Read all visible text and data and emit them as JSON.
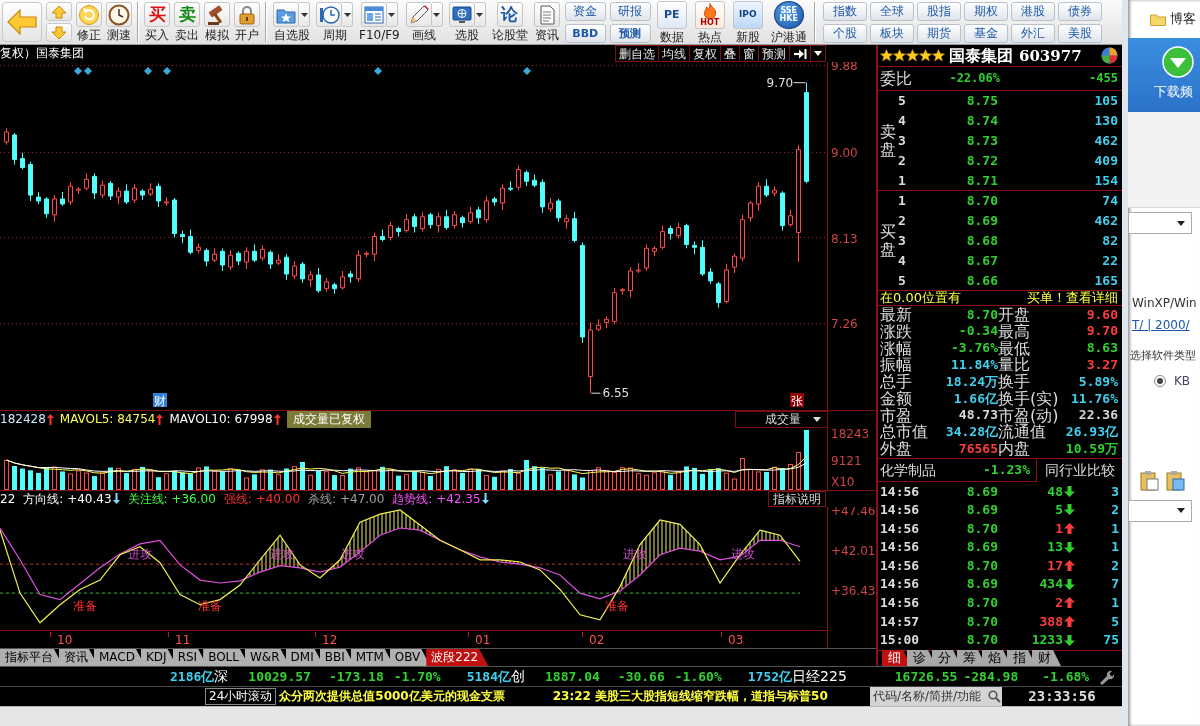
{
  "toolbar": {
    "quick_tools": [
      {
        "label": "修正"
      },
      {
        "label": "测速"
      }
    ],
    "trade_tools": [
      {
        "label": "买入",
        "glyph": "买",
        "color": "#e01010"
      },
      {
        "label": "卖出",
        "glyph": "卖",
        "color": "#108a10"
      },
      {
        "label": "模拟"
      },
      {
        "label": "开户"
      }
    ],
    "menu_tools": [
      {
        "label": "自选股",
        "dropdown": true
      },
      {
        "label": "周期",
        "dropdown": true
      },
      {
        "label": "F10/F9",
        "dropdown": true
      },
      {
        "label": "画线",
        "dropdown": true
      },
      {
        "label": "选股",
        "dropdown": true
      },
      {
        "label": "论股堂",
        "glyph": "论",
        "dropdown": false
      },
      {
        "label": "资讯",
        "dropdown": false
      }
    ],
    "stacked_tools": [
      {
        "top": "资金",
        "bottom": "BBD"
      },
      {
        "top": "研报",
        "bottom": "预测"
      }
    ],
    "feature_tools": [
      {
        "label": "数据",
        "badge": "PE"
      },
      {
        "label": "热点",
        "badge": "HOT"
      },
      {
        "label": "新股",
        "badge": "IPO"
      },
      {
        "label": "沪港通",
        "badge": "SSE HKE"
      }
    ],
    "market_tools": [
      "指数",
      "全球",
      "股指",
      "期权",
      "港股",
      "债券",
      "个股",
      "板块",
      "期货",
      "基金",
      "外汇",
      "美股"
    ]
  },
  "chart": {
    "title": "复权）国泰集团",
    "tools": [
      "删自选",
      "均线",
      "复权",
      "叠",
      "窗",
      "预测"
    ],
    "high_label": "9.70",
    "low_label": "6.55",
    "markers": [
      {
        "text": "财",
        "color": "#2f7fd8"
      },
      {
        "text": "张",
        "color": "#900000"
      }
    ],
    "chart_data": {
      "type": "candlestick",
      "grid": true,
      "ylim": [
        6.38,
        9.91
      ],
      "yticks": [
        {
          "value": 9.88,
          "label": "9.88"
        },
        {
          "value": 9.0,
          "label": "9.00"
        },
        {
          "value": 8.13,
          "label": "8.13"
        },
        {
          "value": 7.26,
          "label": "7.26"
        }
      ],
      "ohlc": [
        [
          9.1,
          9.24,
          9.07,
          9.2
        ],
        [
          9.17,
          9.19,
          8.87,
          8.92
        ],
        [
          8.93,
          8.99,
          8.82,
          8.84
        ],
        [
          8.87,
          8.9,
          8.5,
          8.56
        ],
        [
          8.54,
          8.59,
          8.47,
          8.5
        ],
        [
          8.52,
          8.54,
          8.33,
          8.37
        ],
        [
          8.36,
          8.56,
          8.29,
          8.52
        ],
        [
          8.52,
          8.59,
          8.45,
          8.47
        ],
        [
          8.49,
          8.69,
          8.46,
          8.65
        ],
        [
          8.62,
          8.64,
          8.57,
          8.62
        ],
        [
          8.63,
          8.78,
          8.61,
          8.72
        ],
        [
          8.75,
          8.78,
          8.52,
          8.58
        ],
        [
          8.56,
          8.71,
          8.53,
          8.66
        ],
        [
          8.68,
          8.7,
          8.51,
          8.55
        ],
        [
          8.54,
          8.64,
          8.47,
          8.6
        ],
        [
          8.6,
          8.67,
          8.47,
          8.49
        ],
        [
          8.51,
          8.67,
          8.48,
          8.63
        ],
        [
          8.6,
          8.62,
          8.51,
          8.56
        ],
        [
          8.57,
          8.68,
          8.55,
          8.62
        ],
        [
          8.65,
          8.68,
          8.44,
          8.5
        ],
        [
          8.48,
          8.54,
          8.45,
          8.49
        ],
        [
          8.51,
          8.53,
          8.13,
          8.17
        ],
        [
          8.16,
          8.2,
          8.07,
          8.14
        ],
        [
          8.14,
          8.21,
          7.96,
          7.98
        ],
        [
          8.0,
          8.07,
          7.97,
          8.03
        ],
        [
          8.0,
          8.02,
          7.84,
          7.89
        ],
        [
          7.9,
          8.02,
          7.88,
          7.96
        ],
        [
          7.99,
          8.02,
          7.79,
          7.85
        ],
        [
          7.83,
          8.0,
          7.8,
          7.95
        ],
        [
          7.97,
          7.99,
          7.85,
          7.89
        ],
        [
          7.88,
          8.03,
          7.81,
          7.99
        ],
        [
          7.99,
          8.06,
          7.88,
          7.9
        ],
        [
          7.92,
          8.05,
          7.89,
          8.01
        ],
        [
          7.98,
          8.0,
          7.81,
          7.86
        ],
        [
          7.87,
          7.96,
          7.85,
          7.9
        ],
        [
          7.93,
          7.96,
          7.7,
          7.76
        ],
        [
          7.74,
          7.89,
          7.71,
          7.84
        ],
        [
          7.86,
          7.88,
          7.67,
          7.71
        ],
        [
          7.7,
          7.79,
          7.63,
          7.75
        ],
        [
          7.75,
          7.82,
          7.57,
          7.59
        ],
        [
          7.61,
          7.72,
          7.58,
          7.68
        ],
        [
          7.65,
          7.67,
          7.56,
          7.61
        ],
        [
          7.62,
          7.79,
          7.6,
          7.73
        ],
        [
          7.76,
          7.79,
          7.67,
          7.73
        ],
        [
          7.71,
          8.0,
          7.68,
          7.95
        ],
        [
          7.97,
          7.99,
          7.93,
          7.97
        ],
        [
          7.96,
          8.18,
          7.89,
          8.14
        ],
        [
          8.14,
          8.21,
          8.09,
          8.11
        ],
        [
          8.13,
          8.29,
          8.1,
          8.25
        ],
        [
          8.22,
          8.24,
          8.14,
          8.19
        ],
        [
          8.2,
          8.37,
          8.18,
          8.31
        ],
        [
          8.34,
          8.37,
          8.18,
          8.24
        ],
        [
          8.22,
          8.39,
          8.19,
          8.34
        ],
        [
          8.36,
          8.38,
          8.22,
          8.26
        ],
        [
          8.25,
          8.38,
          8.18,
          8.34
        ],
        [
          8.34,
          8.41,
          8.21,
          8.23
        ],
        [
          8.25,
          8.4,
          8.22,
          8.36
        ],
        [
          8.33,
          8.35,
          8.23,
          8.28
        ],
        [
          8.29,
          8.44,
          8.27,
          8.38
        ],
        [
          8.41,
          8.44,
          8.27,
          8.33
        ],
        [
          8.31,
          8.55,
          8.28,
          8.5
        ],
        [
          8.52,
          8.54,
          8.45,
          8.49
        ],
        [
          8.48,
          8.67,
          8.41,
          8.63
        ],
        [
          8.63,
          8.7,
          8.6,
          8.62
        ],
        [
          8.64,
          8.86,
          8.61,
          8.82
        ],
        [
          8.79,
          8.81,
          8.65,
          8.7
        ],
        [
          8.71,
          8.77,
          8.64,
          8.66
        ],
        [
          8.69,
          8.72,
          8.38,
          8.44
        ],
        [
          8.42,
          8.53,
          8.39,
          8.48
        ],
        [
          8.5,
          8.52,
          8.29,
          8.33
        ],
        [
          8.29,
          8.36,
          8.22,
          8.32
        ],
        [
          8.32,
          8.39,
          8.08,
          8.1
        ],
        [
          8.05,
          8.08,
          7.06,
          7.12
        ],
        [
          6.72,
          7.27,
          6.55,
          7.19
        ],
        [
          7.2,
          7.3,
          7.18,
          7.24
        ],
        [
          7.27,
          7.33,
          7.21,
          7.3
        ],
        [
          7.28,
          7.62,
          7.25,
          7.57
        ],
        [
          7.59,
          7.62,
          7.55,
          7.6
        ],
        [
          7.59,
          7.83,
          7.52,
          7.79
        ],
        [
          7.79,
          7.87,
          7.77,
          7.8
        ],
        [
          7.82,
          8.06,
          7.79,
          8.02
        ],
        [
          7.99,
          8.04,
          7.94,
          8.02
        ],
        [
          8.03,
          8.25,
          8.01,
          8.19
        ],
        [
          8.22,
          8.25,
          8.11,
          8.17
        ],
        [
          8.15,
          8.28,
          8.12,
          8.23
        ],
        [
          8.25,
          8.27,
          8.02,
          8.06
        ],
        [
          8.05,
          8.09,
          7.96,
          8.03
        ],
        [
          8.03,
          8.1,
          7.74,
          7.76
        ],
        [
          7.78,
          7.82,
          7.66,
          7.69
        ],
        [
          7.66,
          7.68,
          7.42,
          7.47
        ],
        [
          7.48,
          7.86,
          7.46,
          7.8
        ],
        [
          7.83,
          7.97,
          7.77,
          7.94
        ],
        [
          7.92,
          8.36,
          7.89,
          8.31
        ],
        [
          8.33,
          8.5,
          8.29,
          8.48
        ],
        [
          8.47,
          8.69,
          8.4,
          8.65
        ],
        [
          8.65,
          8.72,
          8.54,
          8.56
        ],
        [
          8.58,
          8.65,
          8.55,
          8.61
        ],
        [
          8.58,
          8.6,
          8.2,
          8.25
        ],
        [
          8.26,
          8.41,
          8.24,
          8.35
        ],
        [
          8.18,
          9.07,
          7.88,
          9.02
        ],
        [
          9.6,
          9.7,
          8.68,
          8.7
        ]
      ]
    }
  },
  "volume": {
    "readings": [
      {
        "text": "182428",
        "color": "#d0e8ff",
        "rising": true
      },
      {
        "text": "MAVOL5: 84754",
        "color": "#ffff50",
        "rising": true
      },
      {
        "text": "MAVOL10: 67998",
        "color": "#ffffff",
        "rising": true
      }
    ],
    "tooltip": "成交量已复权",
    "selector": "成交量",
    "ticks": [
      "18243",
      "9121",
      "X10"
    ]
  },
  "indicator": {
    "readings": [
      {
        "text": "22",
        "color": "#ffffff",
        "falling": false
      },
      {
        "text": "方向线: +40.43",
        "color": "#ffffff",
        "falling": true
      },
      {
        "text": "关注线: +36.00",
        "color": "#40ff40",
        "falling": false
      },
      {
        "text": "强线: +40.00",
        "color": "#ff3030",
        "falling": false
      },
      {
        "text": "杀线: +47.00",
        "color": "#a0a0a0",
        "falling": false
      },
      {
        "text": "趋势线: +42.35",
        "color": "#ff50ff",
        "falling": true
      }
    ],
    "help_button": "指标说明",
    "chart_data": {
      "type": "line",
      "ylim": [
        30.9,
        47.9
      ],
      "yticks": [
        {
          "value": 47.46,
          "label": "+47.46"
        },
        {
          "value": 42.01,
          "label": "+42.01"
        },
        {
          "value": 36.43,
          "label": "+36.43"
        }
      ],
      "series": [
        {
          "color": "#f0f050",
          "values": [
            44.7,
            36.0,
            31.9,
            34.4,
            36.5,
            37.8,
            41.3,
            42.4,
            40.2,
            35.8,
            34.4,
            35.1,
            37.1,
            40.6,
            44.0,
            39.9,
            38.1,
            40.6,
            45.8,
            46.9,
            47.5,
            45.4,
            43.3,
            42.0,
            40.6,
            40.6,
            40.3,
            39.2,
            36.5,
            33.0,
            32.3,
            36.9,
            42.7,
            46.1,
            45.5,
            42.7,
            37.4,
            41.3,
            44.7,
            44.0,
            40.4
          ]
        },
        {
          "color": "#e050e0",
          "values": [
            45.0,
            40.6,
            35.8,
            35.1,
            37.3,
            39.5,
            41.4,
            42.8,
            43.3,
            39.9,
            37.8,
            37.4,
            37.7,
            38.9,
            39.8,
            39.5,
            38.9,
            39.6,
            41.7,
            44.0,
            45.0,
            44.7,
            43.3,
            42.0,
            41.0,
            40.3,
            40.0,
            39.5,
            38.5,
            36.0,
            35.2,
            36.3,
            38.5,
            41.3,
            42.2,
            41.8,
            40.6,
            41.1,
            43.3,
            43.3,
            42.4
          ]
        },
        {
          "color": "#c03030",
          "line_style": "dashed",
          "values": [
            40.0,
            40.0,
            40.0,
            40.0,
            40.0,
            40.0,
            40.0,
            40.0,
            40.0,
            40.0,
            40.0,
            40.0,
            40.0,
            40.0,
            40.0,
            40.0,
            40.0,
            40.0,
            40.0,
            40.0,
            40.0,
            40.0,
            40.0,
            40.0,
            40.0,
            40.0,
            40.0,
            40.0,
            40.0,
            40.0,
            40.0,
            40.0,
            40.0,
            40.0,
            40.0,
            40.0,
            40.0,
            40.0,
            40.0,
            40.0,
            40.0
          ]
        },
        {
          "color": "#30c030",
          "line_style": "dashed",
          "values": [
            36.0,
            36.0,
            36.0,
            36.0,
            36.0,
            36.0,
            36.0,
            36.0,
            36.0,
            36.0,
            36.0,
            36.0,
            36.0,
            36.0,
            36.0,
            36.0,
            36.0,
            36.0,
            36.0,
            36.0,
            36.0,
            36.0,
            36.0,
            36.0,
            36.0,
            36.0,
            36.0,
            36.0,
            36.0,
            36.0,
            36.0,
            36.0,
            36.0,
            36.0,
            36.0,
            36.0,
            36.0,
            36.0,
            36.0,
            36.0,
            36.0
          ]
        }
      ]
    },
    "signals": [
      {
        "text": "进攻",
        "kind": "attack"
      },
      {
        "text": "进攻",
        "kind": "attack"
      },
      {
        "text": "进攻",
        "kind": "attack"
      },
      {
        "text": "进攻",
        "kind": "attack"
      },
      {
        "text": "进攻",
        "kind": "attack"
      },
      {
        "text": "准备",
        "kind": "ready"
      },
      {
        "text": "准备",
        "kind": "ready"
      },
      {
        "text": "准备",
        "kind": "ready"
      }
    ]
  },
  "x_labels": [
    "10",
    "11",
    "12",
    "01",
    "02",
    "03"
  ],
  "indicator_tabs": [
    {
      "label": "指标平台",
      "selected": false
    },
    {
      "label": "资讯",
      "selected": false
    },
    {
      "label": "MACD",
      "selected": false
    },
    {
      "label": "KDJ",
      "selected": false
    },
    {
      "label": "RSI",
      "selected": false
    },
    {
      "label": "BOLL",
      "selected": false
    },
    {
      "label": "W&R",
      "selected": false
    },
    {
      "label": "DMI",
      "selected": false
    },
    {
      "label": "BBI",
      "selected": false
    },
    {
      "label": "MTM",
      "selected": false
    },
    {
      "label": "OBV",
      "selected": false
    },
    {
      "label": "波段222",
      "selected": true
    }
  ],
  "quote": {
    "stars": 5,
    "name": "国泰集团",
    "code": "603977",
    "ratio": {
      "label": "委比",
      "percent": "-22.06%",
      "difference": "-455"
    },
    "sell_label": "卖盘",
    "sell": [
      {
        "rank": "5",
        "price": "8.75",
        "volume": "105"
      },
      {
        "rank": "4",
        "price": "8.74",
        "volume": "130"
      },
      {
        "rank": "3",
        "price": "8.73",
        "volume": "462"
      },
      {
        "rank": "2",
        "price": "8.72",
        "volume": "409"
      },
      {
        "rank": "1",
        "price": "8.71",
        "volume": "154"
      }
    ],
    "buy_label": "买盘",
    "buy": [
      {
        "rank": "1",
        "price": "8.70",
        "volume": "74"
      },
      {
        "rank": "2",
        "price": "8.69",
        "volume": "462"
      },
      {
        "rank": "3",
        "price": "8.68",
        "volume": "82"
      },
      {
        "rank": "4",
        "price": "8.67",
        "volume": "22"
      },
      {
        "rank": "5",
        "price": "8.66",
        "volume": "165"
      }
    ],
    "notice": {
      "text": "在0.00位置有",
      "link": "买单！查看详细"
    },
    "stats": [
      {
        "label": "最新",
        "value": "8.70",
        "color": "#30d030"
      },
      {
        "label": "开盘",
        "value": "9.60",
        "color": "#ff3c3c"
      },
      {
        "label": "涨跌",
        "value": "-0.34",
        "color": "#30d030"
      },
      {
        "label": "最高",
        "value": "9.70",
        "color": "#ff3c3c"
      },
      {
        "label": "涨幅",
        "value": "-3.76%",
        "color": "#30d030"
      },
      {
        "label": "最低",
        "value": "8.63",
        "color": "#30d030"
      },
      {
        "label": "振幅",
        "value": "11.84%",
        "color": "#40d0f0"
      },
      {
        "label": "量比",
        "value": "3.27",
        "color": "#ff3c3c"
      },
      {
        "label": "总手",
        "value": "18.24万",
        "color": "#40d0f0"
      },
      {
        "label": "换手",
        "value": "5.89%",
        "color": "#40d0f0"
      },
      {
        "label": "金额",
        "value": "1.66亿",
        "color": "#40d0f0"
      },
      {
        "label": "换手(实)",
        "value": "11.76%",
        "color": "#40d0f0"
      },
      {
        "label": "市盈",
        "value": "48.73",
        "color": "#d8d8d8"
      },
      {
        "label": "市盈(动)",
        "value": "22.36",
        "color": "#d8d8d8"
      },
      {
        "label": "总市值",
        "value": "34.28亿",
        "color": "#40d0f0"
      },
      {
        "label": "流通值",
        "value": "26.93亿",
        "color": "#40d0f0"
      },
      {
        "label": "外盘",
        "value": "76565",
        "color": "#ff3c3c"
      },
      {
        "label": "内盘",
        "value": "10.59万",
        "color": "#30d030"
      }
    ],
    "industry": {
      "name": "化学制品",
      "change": "-1.23%",
      "button": "同行业比较"
    },
    "ticks": [
      {
        "time": "14:56",
        "price": "8.69",
        "volume": "48",
        "rising": false,
        "count": "3"
      },
      {
        "time": "14:56",
        "price": "8.69",
        "volume": "5",
        "rising": false,
        "count": "2"
      },
      {
        "time": "14:56",
        "price": "8.70",
        "volume": "1",
        "rising": true,
        "count": "1"
      },
      {
        "time": "14:56",
        "price": "8.69",
        "volume": "13",
        "rising": false,
        "count": "1"
      },
      {
        "time": "14:56",
        "price": "8.70",
        "volume": "17",
        "rising": true,
        "count": "2"
      },
      {
        "time": "14:56",
        "price": "8.69",
        "volume": "434",
        "rising": false,
        "count": "7"
      },
      {
        "time": "14:56",
        "price": "8.70",
        "volume": "2",
        "rising": true,
        "count": "1"
      },
      {
        "time": "14:57",
        "price": "8.70",
        "volume": "388",
        "rising": true,
        "count": "5"
      },
      {
        "time": "15:00",
        "price": "8.70",
        "volume": "1233",
        "rising": false,
        "count": "75"
      }
    ],
    "tabs": [
      {
        "label": "细",
        "selected": true
      },
      {
        "label": "诊",
        "selected": false
      },
      {
        "label": "分",
        "selected": false
      },
      {
        "label": "筹",
        "selected": false
      },
      {
        "label": "焰",
        "selected": false
      },
      {
        "label": "指",
        "selected": false
      },
      {
        "label": "财",
        "selected": false
      }
    ]
  },
  "status": {
    "lead_amount": "2186亿",
    "indices": [
      {
        "name": "深",
        "value": "10029.57",
        "change": "-173.18",
        "percent": "-1.70%",
        "amount": "5184亿"
      },
      {
        "name": "创",
        "value": "1887.04",
        "change": "-30.66",
        "percent": "-1.60%",
        "amount": "1752亿"
      },
      {
        "name": "日经225",
        "value": "16726.55",
        "change": "-284.98",
        "percent": "-1.68%"
      }
    ],
    "ticker_label": "24小时滚动",
    "news": [
      "众分两次提供总值5000亿美元的现金支票",
      "23:22 美股三大股指短线缩窄跌幅，道指与标普50"
    ],
    "search": {
      "placeholder": "代码/名称/简拼/功能"
    },
    "clock": "23:33:56"
  },
  "background_window": {
    "bookmark": "博客",
    "banner": "下载频",
    "os_text": "WinXP/Win",
    "links": "T/ | 2000/",
    "field_label": "选择软件类型",
    "radio": {
      "label": "KB",
      "checked": true
    }
  }
}
